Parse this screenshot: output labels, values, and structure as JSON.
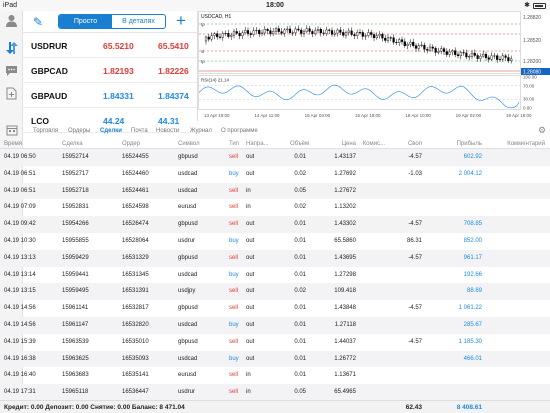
{
  "status": {
    "device": "iPad",
    "time": "18:00"
  },
  "quotes": {
    "mode_simple": "Просто",
    "mode_detailed": "В деталях",
    "rows": [
      {
        "symbol": "USDRUR",
        "bid": "65.5210",
        "ask": "65.5410",
        "color": "red"
      },
      {
        "symbol": "GBPCAD",
        "bid": "1.82193",
        "ask": "1.82226",
        "color": "red"
      },
      {
        "symbol": "GBPAUD",
        "bid": "1.84331",
        "ask": "1.84374",
        "color": "blue"
      },
      {
        "symbol": "LCO",
        "bid": "44.24",
        "ask": "44.31",
        "color": "blue"
      }
    ]
  },
  "chart": {
    "title": "USDCAD, H1",
    "price_labels": [
      "1.28820",
      "1.28520",
      "1.28200",
      "1.28080"
    ],
    "left_labels": [
      "tp",
      "sl",
      "tp"
    ],
    "price_badge": "1.28080",
    "rsi_label": "RSI(14) 21.14",
    "rsi_ticks": [
      "100.00",
      "70.00",
      "30.00",
      "0.00"
    ],
    "time_ticks": [
      "13 Apr 19:00",
      "14 Apr 11:00",
      "15 Apr 03:00",
      "15 Apr 19:00",
      "18 Apr 10:00",
      "19 Apr 02:00",
      "19 Apr 18:00"
    ],
    "rsi_value": 21.14
  },
  "tabs": [
    {
      "label": "Торговля",
      "active": false
    },
    {
      "label": "Ордеры",
      "active": false
    },
    {
      "label": "Сделки",
      "active": true
    },
    {
      "label": "Почта",
      "active": false
    },
    {
      "label": "Новости",
      "active": false
    },
    {
      "label": "Журнал",
      "active": false
    },
    {
      "label": "О программе",
      "active": false
    }
  ],
  "table": {
    "headers": [
      "Время",
      "Сделка",
      "Ордер",
      "Символ",
      "Тип",
      "Напра...",
      "Объём",
      "Цена",
      "Комис...",
      "Своп",
      "Прибыль",
      "Комментарий"
    ],
    "rows": [
      [
        "04.19 06:50",
        "15952714",
        "16524455",
        "gbpusd",
        "sell",
        "out",
        "0.01",
        "1.43137",
        "",
        "-4.57",
        "602.92",
        ""
      ],
      [
        "04.19 06:51",
        "15952717",
        "16524460",
        "usdcad",
        "buy",
        "out",
        "0.02",
        "1.27692",
        "",
        "-1.03",
        "2 004.12",
        ""
      ],
      [
        "04.19 06:51",
        "15952718",
        "16524461",
        "usdcad",
        "sell",
        "in",
        "0.05",
        "1.27672",
        "",
        "",
        "",
        ""
      ],
      [
        "04.19 07:09",
        "15952831",
        "16524598",
        "eurusd",
        "sell",
        "in",
        "0.02",
        "1.13202",
        "",
        "",
        "",
        ""
      ],
      [
        "04.19 09:42",
        "15954266",
        "16526474",
        "gbpusd",
        "sell",
        "out",
        "0.01",
        "1.43302",
        "",
        "-4.57",
        "708.85",
        ""
      ],
      [
        "04.19 10:30",
        "15955855",
        "16528064",
        "usdrur",
        "buy",
        "out",
        "0.01",
        "65.5860",
        "",
        "86.31",
        "852.00",
        ""
      ],
      [
        "04.19 13:13",
        "15959429",
        "16531329",
        "gbpusd",
        "sell",
        "out",
        "0.01",
        "1.43695",
        "",
        "-4.57",
        "961.17",
        ""
      ],
      [
        "04.19 13:14",
        "15959441",
        "16531345",
        "usdcad",
        "buy",
        "out",
        "0.01",
        "1.27298",
        "",
        "",
        "192.66",
        ""
      ],
      [
        "04.19 13:15",
        "15959495",
        "16531391",
        "usdjpy",
        "sell",
        "out",
        "0.02",
        "109.418",
        "",
        "",
        "88.69",
        ""
      ],
      [
        "04.19 14:56",
        "15961141",
        "16532817",
        "gbpusd",
        "sell",
        "out",
        "0.01",
        "1.43848",
        "",
        "-4.57",
        "1 061.22",
        ""
      ],
      [
        "04.19 14:56",
        "15961147",
        "16532820",
        "usdcad",
        "buy",
        "out",
        "0.01",
        "1.27118",
        "",
        "",
        "285.67",
        ""
      ],
      [
        "04.19 15:39",
        "15963539",
        "16535010",
        "gbpusd",
        "sell",
        "out",
        "0.01",
        "1.44037",
        "",
        "-4.57",
        "1 185.30",
        ""
      ],
      [
        "04.19 16:38",
        "15963625",
        "16535093",
        "usdcad",
        "buy",
        "out",
        "0.01",
        "1.26772",
        "",
        "",
        "466.01",
        ""
      ],
      [
        "04.19 16:40",
        "15963683",
        "16535141",
        "eurusd",
        "sell",
        "in",
        "0.01",
        "1.13671",
        "",
        "",
        "",
        ""
      ],
      [
        "04.19 17:31",
        "15965118",
        "16536447",
        "usdrur",
        "sell",
        "in",
        "0.05",
        "65.4965",
        "",
        "",
        "",
        ""
      ]
    ]
  },
  "footer": {
    "summary": "Кредит: 0.00 Депозит: 0.00 Снятие: 0.00 Баланс: 8 471.04",
    "swap_total": "62.43",
    "profit_total": "8 408.61"
  }
}
